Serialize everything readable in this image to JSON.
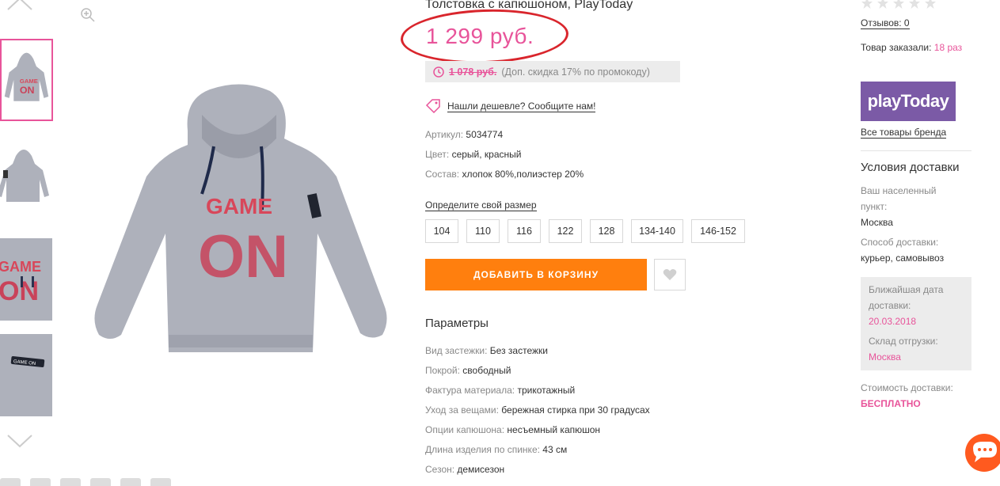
{
  "product": {
    "title": "Толстовка с капюшоном, PlayToday",
    "price": "1 299 руб.",
    "promo_price": "1 078 руб.",
    "promo_note": "(Доп. скидка 17% по промокоду)",
    "cheaper_link": "Нашли дешевле? Сообщите нам!"
  },
  "attributes": [
    {
      "key": "Артикул:",
      "value": "5034774"
    },
    {
      "key": "Цвет:",
      "value": "серый, красный"
    },
    {
      "key": "Состав:",
      "value": "хлопок 80%,полиэстер 20%"
    }
  ],
  "size_link": "Определите свой размер",
  "sizes": [
    "104",
    "110",
    "116",
    "122",
    "128",
    "134-140",
    "146-152"
  ],
  "add_to_cart": "ДОБАВИТЬ В КОРЗИНУ",
  "params_title": "Параметры",
  "params": [
    {
      "key": "Вид застежки:",
      "value": "Без застежки"
    },
    {
      "key": "Покрой:",
      "value": "свободный"
    },
    {
      "key": "Фактура материала:",
      "value": "трикотажный"
    },
    {
      "key": "Уход за вещами:",
      "value": "бережная стирка при 30 градусах"
    },
    {
      "key": "Опции капюшона:",
      "value": "несъемный капюшон"
    },
    {
      "key": "Длина изделия по спинке:",
      "value": "43 см"
    },
    {
      "key": "Сезон:",
      "value": "демисезон"
    }
  ],
  "sidebar": {
    "reviews": "Отзывов: 0",
    "ordered_label": "Товар заказали:",
    "ordered_count": "18 раз",
    "brand_logo": "playToday",
    "brand_link": "Все товары бренда",
    "delivery_title": "Условия доставки",
    "city_label": "Ваш населенный пункт:",
    "city": "Москва",
    "method_label": "Способ доставки:",
    "method": "курьер, самовывоз",
    "date_label": "Ближайшая дата доставки:",
    "date": "20.03.2018",
    "warehouse_label": "Склад отгрузки:",
    "warehouse": "Москва",
    "cost_label": "Стоимость доставки:",
    "cost": "БЕСПЛАТНО"
  },
  "colors": {
    "accent_pink": "#e8549a",
    "cart_orange": "#ff7f0e",
    "brand_purple": "#7b5aa6",
    "annotation_red": "#d9252c"
  },
  "rating": 0
}
